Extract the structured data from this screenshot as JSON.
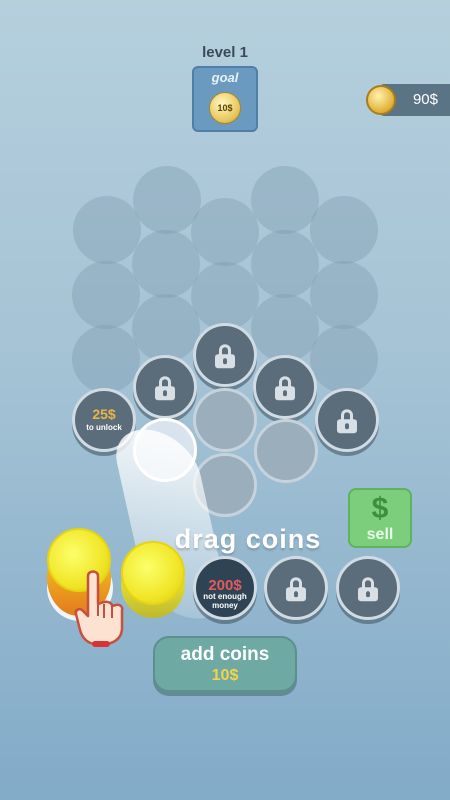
{
  "header": {
    "level_label": "level 1",
    "goal_title": "goal",
    "goal_coin_value": "10$"
  },
  "wallet": {
    "money": "90$",
    "coin_icon": "gold-coin-icon"
  },
  "board": {
    "unlock_slot": {
      "price": "25$",
      "sub": "to unlock"
    }
  },
  "hint": {
    "drag_text": "drag coins"
  },
  "sell": {
    "icon": "$",
    "label": "sell"
  },
  "tray": {
    "not_enough": {
      "price": "200$",
      "sub": "not enough money"
    }
  },
  "add_coins": {
    "label": "add coins",
    "price": "10$"
  },
  "colors": {
    "coin_yellow": "#f1e628",
    "sell_green": "#7ccd7c",
    "locked_slot": "#5b6d7a",
    "price_gold": "#e9b54a",
    "price_red": "#e35a5a"
  }
}
